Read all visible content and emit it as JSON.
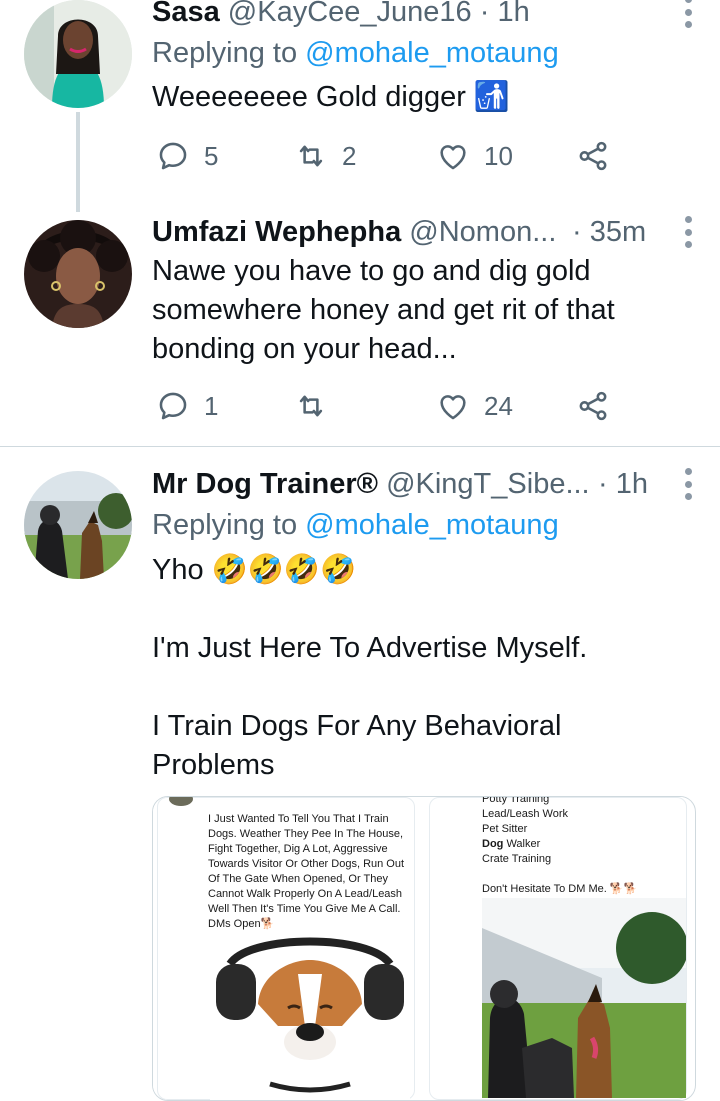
{
  "tweets": [
    {
      "name": "Sasa",
      "handle": "@KayCee_June16",
      "time": "· 1h",
      "replying_prefix": "Replying to ",
      "replying_handle": "@mohale_motaung",
      "text": "Weeeeeeee Gold digger 🚮",
      "replies": "5",
      "retweets": "2",
      "likes": "10"
    },
    {
      "name": "Umfazi Wephepha",
      "handle": "@Nomon...",
      "time": "· 35m",
      "text": "Nawe you have to go and dig gold somewhere honey and get rit of that bonding on your head...",
      "replies": "1",
      "retweets": "",
      "likes": "24"
    },
    {
      "name": "Mr Dog Trainer®",
      "handle": "@KingT_Sibe...",
      "time": "· 1h",
      "replying_prefix": "Replying to ",
      "replying_handle": "@mohale_motaung",
      "text_lines": [
        "Yho 🤣🤣🤣🤣",
        "",
        "I'm Just Here To Advertise Myself.",
        "",
        "I Train Dogs For Any Behavioral Problems"
      ]
    }
  ],
  "media": {
    "left_card_text": "I Just Wanted To Tell You That I Train Dogs. Weather They Pee In The House, Fight Together, Dig A Lot, Aggressive Towards Visitor Or Other Dogs, Run Out Of The Gate When Opened, Or They Cannot Walk Properly On A Lead/Leash Well Then It's Time You Give Me A Call. DMs Open🐕",
    "right_card_lines": [
      "Potty Training",
      "Lead/Leash Work",
      "Pet Sitter",
      "Dog Walker",
      "Crate Training"
    ],
    "right_card_bold_word": "Dog",
    "right_card_cta": "Don't Hesitate To DM Me. 🐕🐕"
  },
  "colors": {
    "secondary_text": "#536471",
    "link": "#1d9bf0",
    "divider": "#cfd9de"
  },
  "icons": [
    "reply-icon",
    "retweet-icon",
    "like-icon",
    "share-icon",
    "more-icon"
  ]
}
